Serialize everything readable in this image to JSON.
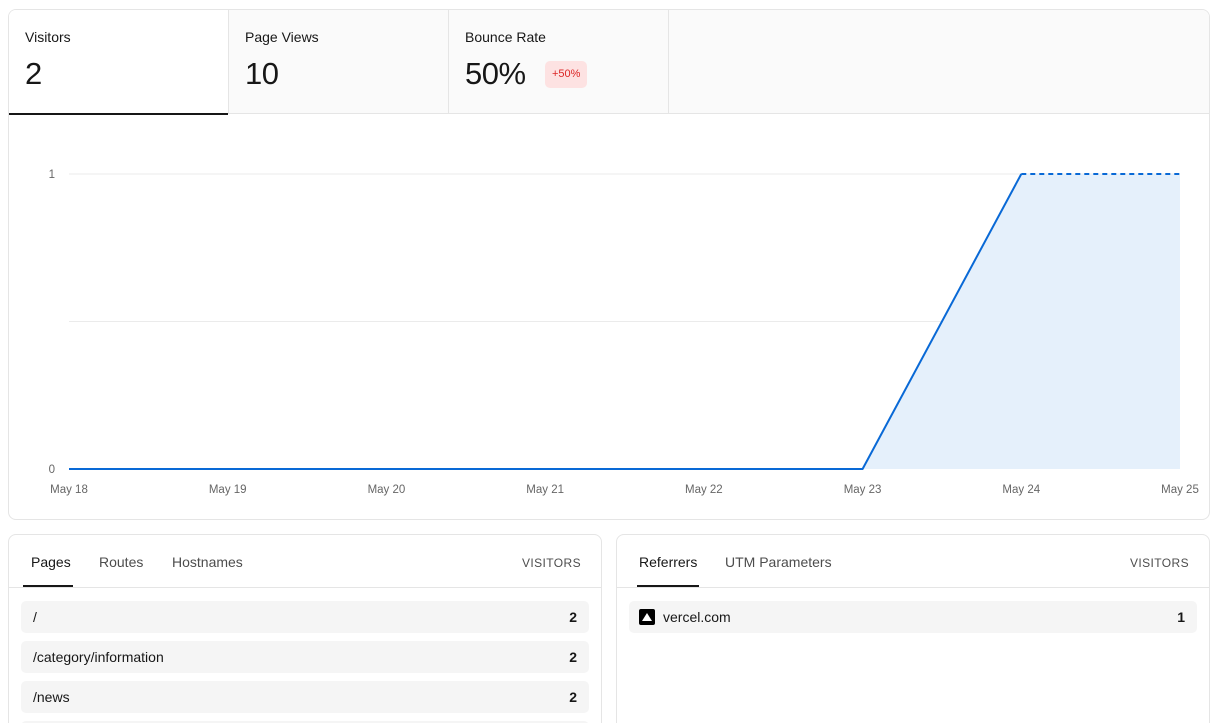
{
  "stats": {
    "visitors": {
      "label": "Visitors",
      "value": "2"
    },
    "page_views": {
      "label": "Page Views",
      "value": "10"
    },
    "bounce_rate": {
      "label": "Bounce Rate",
      "value": "50%",
      "delta": "+50%"
    }
  },
  "chart_data": {
    "type": "area",
    "x": [
      "May 18",
      "May 19",
      "May 20",
      "May 21",
      "May 22",
      "May 23",
      "May 24",
      "May 25"
    ],
    "series": [
      {
        "values": [
          0,
          0,
          0,
          0,
          0,
          0,
          1,
          1
        ]
      }
    ],
    "ylim": [
      0,
      1
    ],
    "yticks": [
      "0",
      "1"
    ],
    "grid": true,
    "dashed_from": "May 24",
    "color": "#0969d6",
    "fill_color": "#e5f0fb"
  },
  "pages_panel": {
    "tabs": [
      "Pages",
      "Routes",
      "Hostnames"
    ],
    "column_header": "VISITORS",
    "rows": [
      {
        "label": "/",
        "value": "2"
      },
      {
        "label": "/category/information",
        "value": "2"
      },
      {
        "label": "/news",
        "value": "2"
      }
    ]
  },
  "referrers_panel": {
    "tabs": [
      "Referrers",
      "UTM Parameters"
    ],
    "column_header": "VISITORS",
    "rows": [
      {
        "label": "vercel.com",
        "value": "1",
        "icon": "vercel-icon"
      }
    ]
  }
}
